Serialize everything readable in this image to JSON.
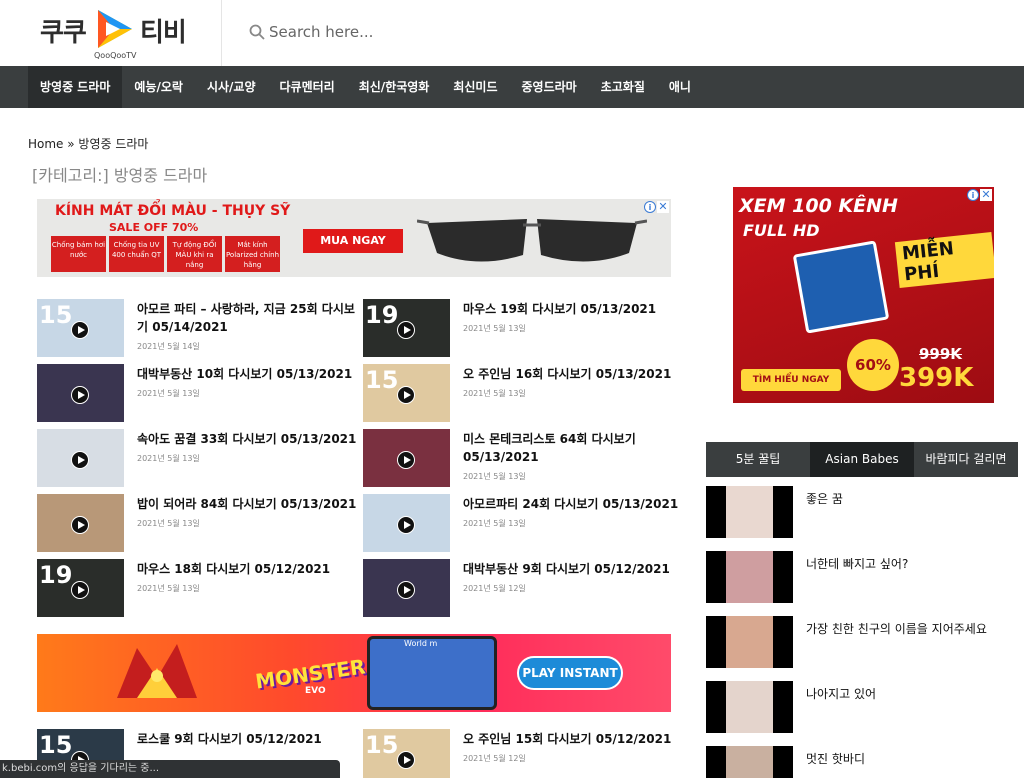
{
  "header": {
    "logo_left": "쿠쿠",
    "logo_right": "티비",
    "logo_sub": "QooQooTV",
    "search_placeholder": "Search here..."
  },
  "nav": [
    {
      "label": "방영중 드라마",
      "active": true
    },
    {
      "label": "예능/오락"
    },
    {
      "label": "시사/교양"
    },
    {
      "label": "다큐멘터리"
    },
    {
      "label": "최신/한국영화"
    },
    {
      "label": "최신미드"
    },
    {
      "label": "중영드라마"
    },
    {
      "label": "초고화질"
    },
    {
      "label": "애니"
    }
  ],
  "breadcrumb": {
    "home": "Home",
    "sep": " » ",
    "current": "방영중 드라마"
  },
  "category_title": "[카테고리:] 방영중 드라마",
  "ad_glasses": {
    "title": "KÍNH MÁT ĐỔI MÀU - THỤY SỸ",
    "sale": "SALE OFF 70%",
    "features": [
      "Chống bám hơi nước",
      "Chống tia UV 400 chuẩn QT",
      "Tự động ĐỔI MÀU khi ra nắng",
      "Mắt kính Polarized chính hãng"
    ],
    "cta": "MUA NGAY"
  },
  "ad_monster": {
    "title": "MONSTER",
    "sub": "EVO",
    "phone_label": "World m",
    "cta": "PLAY INSTANT"
  },
  "ad_tv": {
    "line1": "XEM 100 KÊNH",
    "line2": "FULL HD",
    "free": "MIỄN PHÍ",
    "old_price": "999K",
    "new_price": "399K",
    "discount": "60%",
    "cta": "TÌM HIỂU NGAY"
  },
  "posts": [
    {
      "title": "아모르 파티 – 사랑하라, 지금 25회 다시보기 05/14/2021",
      "date": "2021년 5월 14일",
      "thumb": "#c7d7e6",
      "num": "15"
    },
    {
      "title": "마우스 19회 다시보기 05/13/2021",
      "date": "2021년 5월 13일",
      "thumb": "#2a2d2a",
      "num": "19"
    },
    {
      "title": "대박부동산 10회 다시보기 05/13/2021",
      "date": "2021년 5월 13일",
      "thumb": "#3a3550",
      "num": ""
    },
    {
      "title": "오 주인님 16회 다시보기 05/13/2021",
      "date": "2021년 5월 13일",
      "thumb": "#e0c9a0",
      "num": "15"
    },
    {
      "title": "속아도 꿈결 33회 다시보기 05/13/2021",
      "date": "2021년 5월 13일",
      "thumb": "#d7dde4",
      "num": ""
    },
    {
      "title": "미스 몬테크리스토 64회 다시보기 05/13/2021",
      "date": "2021년 5월 13일",
      "thumb": "#7a3040",
      "num": ""
    },
    {
      "title": "밥이 되어라 84회 다시보기 05/13/2021",
      "date": "2021년 5월 13일",
      "thumb": "#b89878",
      "num": ""
    },
    {
      "title": "아모르파티 24회 다시보기 05/13/2021",
      "date": "2021년 5월 13일",
      "thumb": "#c7d7e6",
      "num": ""
    },
    {
      "title": "마우스 18회 다시보기 05/12/2021",
      "date": "2021년 5월 13일",
      "thumb": "#2a2d2a",
      "num": "19"
    },
    {
      "title": "대박부동산 9회 다시보기 05/12/2021",
      "date": "2021년 5월 12일",
      "thumb": "#3a3550",
      "num": ""
    },
    {
      "title": "로스쿨 9회 다시보기 05/12/2021",
      "date": "",
      "thumb": "#2b3a48",
      "num": "15"
    },
    {
      "title": "오 주인님 15회 다시보기 05/12/2021",
      "date": "2021년 5월 12일",
      "thumb": "#e0c9a0",
      "num": "15"
    }
  ],
  "sidebar": {
    "tabs": [
      "5분 꿀팁",
      "Asian Babes",
      "바람피다 걸리면"
    ],
    "items": [
      {
        "title": "좋은 꿈",
        "photo": "#e9d8d0"
      },
      {
        "title": "너한테 빠지고 싶어?",
        "photo": "#cf9ea0"
      },
      {
        "title": "가장 친한 친구의 이름을 지어주세요",
        "photo": "#d8a890"
      },
      {
        "title": "나아지고 있어",
        "photo": "#e4d4cc"
      },
      {
        "title": "멋진 핫바디",
        "photo": "#c9b0a0"
      }
    ]
  },
  "statusbar": "k.bebi.com의 응답을 기다리는 중..."
}
